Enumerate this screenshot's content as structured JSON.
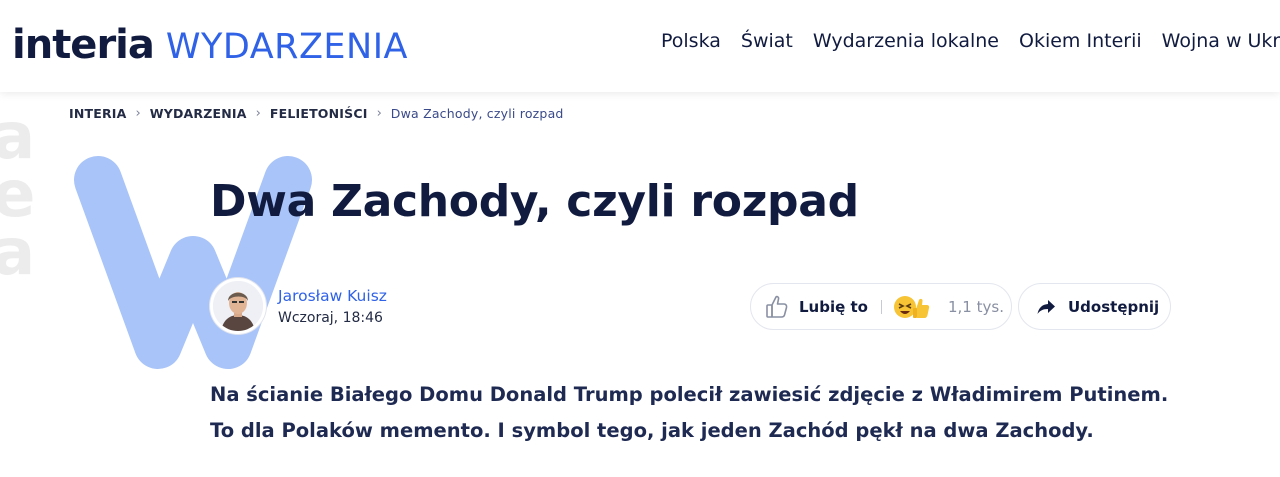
{
  "header": {
    "logo_main": "interia",
    "logo_section": "WYDARZENIA",
    "nav": [
      "Polska",
      "Świat",
      "Wydarzenia lokalne",
      "Okiem Interii",
      "Wojna w Ukra"
    ]
  },
  "breadcrumb": {
    "items": [
      "INTERIA",
      "WYDARZENIA",
      "FELIETONIŚCI",
      "Dwa Zachody, czyli rozpad"
    ],
    "separator": "›"
  },
  "article": {
    "title": "Dwa Zachody, czyli rozpad",
    "author": "Jarosław Kuisz",
    "date": "Wczoraj, 18:46",
    "lead": [
      "Na ścianie Białego Domu Donald Trump polecił zawiesić zdjęcie z Władimirem Putinem.",
      "To dla Polaków memento. I symbol tego, jak jeden Zachód pękł na dwa Zachody."
    ]
  },
  "actions": {
    "like_label": "Lubię to",
    "like_count": "1,1 tys.",
    "share_label": "Udostępnij"
  },
  "colors": {
    "brand_blue": "#2f62e6",
    "watermark_blue": "#a9c4f8",
    "text_dark": "#111b3f"
  },
  "icons": {
    "like": "thumbs-up-outline-icon",
    "reactions": "reaction-emojis-icon",
    "share": "share-arrow-icon"
  }
}
